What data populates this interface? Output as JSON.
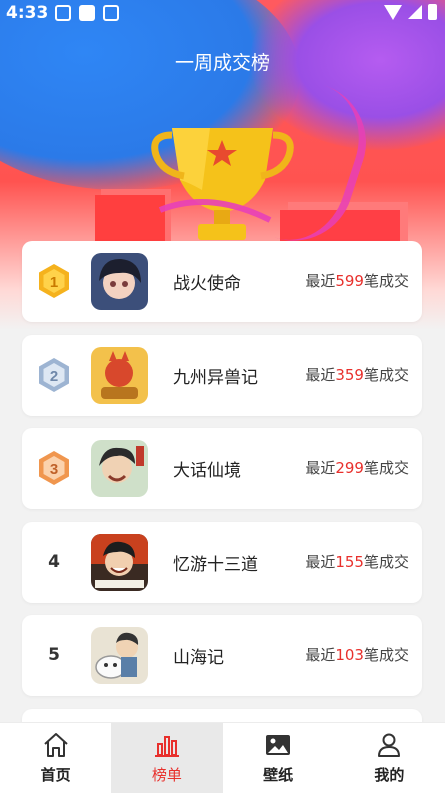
{
  "status_bar": {
    "time": "4:33"
  },
  "header": {
    "title": "一周成交榜"
  },
  "ranking": [
    {
      "rank": "1",
      "name": "战火使命",
      "prefix": "最近",
      "count": "599",
      "suffix": "笔成交",
      "badge": "gold"
    },
    {
      "rank": "2",
      "name": "九州异兽记",
      "prefix": "最近",
      "count": "359",
      "suffix": "笔成交",
      "badge": "silver"
    },
    {
      "rank": "3",
      "name": "大话仙境",
      "prefix": "最近",
      "count": "299",
      "suffix": "笔成交",
      "badge": "bronze"
    },
    {
      "rank": "4",
      "name": "忆游十三道",
      "prefix": "最近",
      "count": "155",
      "suffix": "笔成交",
      "badge": "none"
    },
    {
      "rank": "5",
      "name": "山海记",
      "prefix": "最近",
      "count": "103",
      "suffix": "笔成交",
      "badge": "none"
    }
  ],
  "bottom_nav": {
    "items": [
      {
        "label": "首页",
        "icon": "home-icon"
      },
      {
        "label": "榜单",
        "icon": "chart-icon",
        "active": true
      },
      {
        "label": "壁纸",
        "icon": "image-icon"
      },
      {
        "label": "我的",
        "icon": "user-icon"
      }
    ]
  },
  "colors": {
    "accent": "#e8302c",
    "hero": "#ff5a5f",
    "gold": "#f5b21d",
    "silver": "#9db4d2",
    "bronze": "#f0964e"
  }
}
